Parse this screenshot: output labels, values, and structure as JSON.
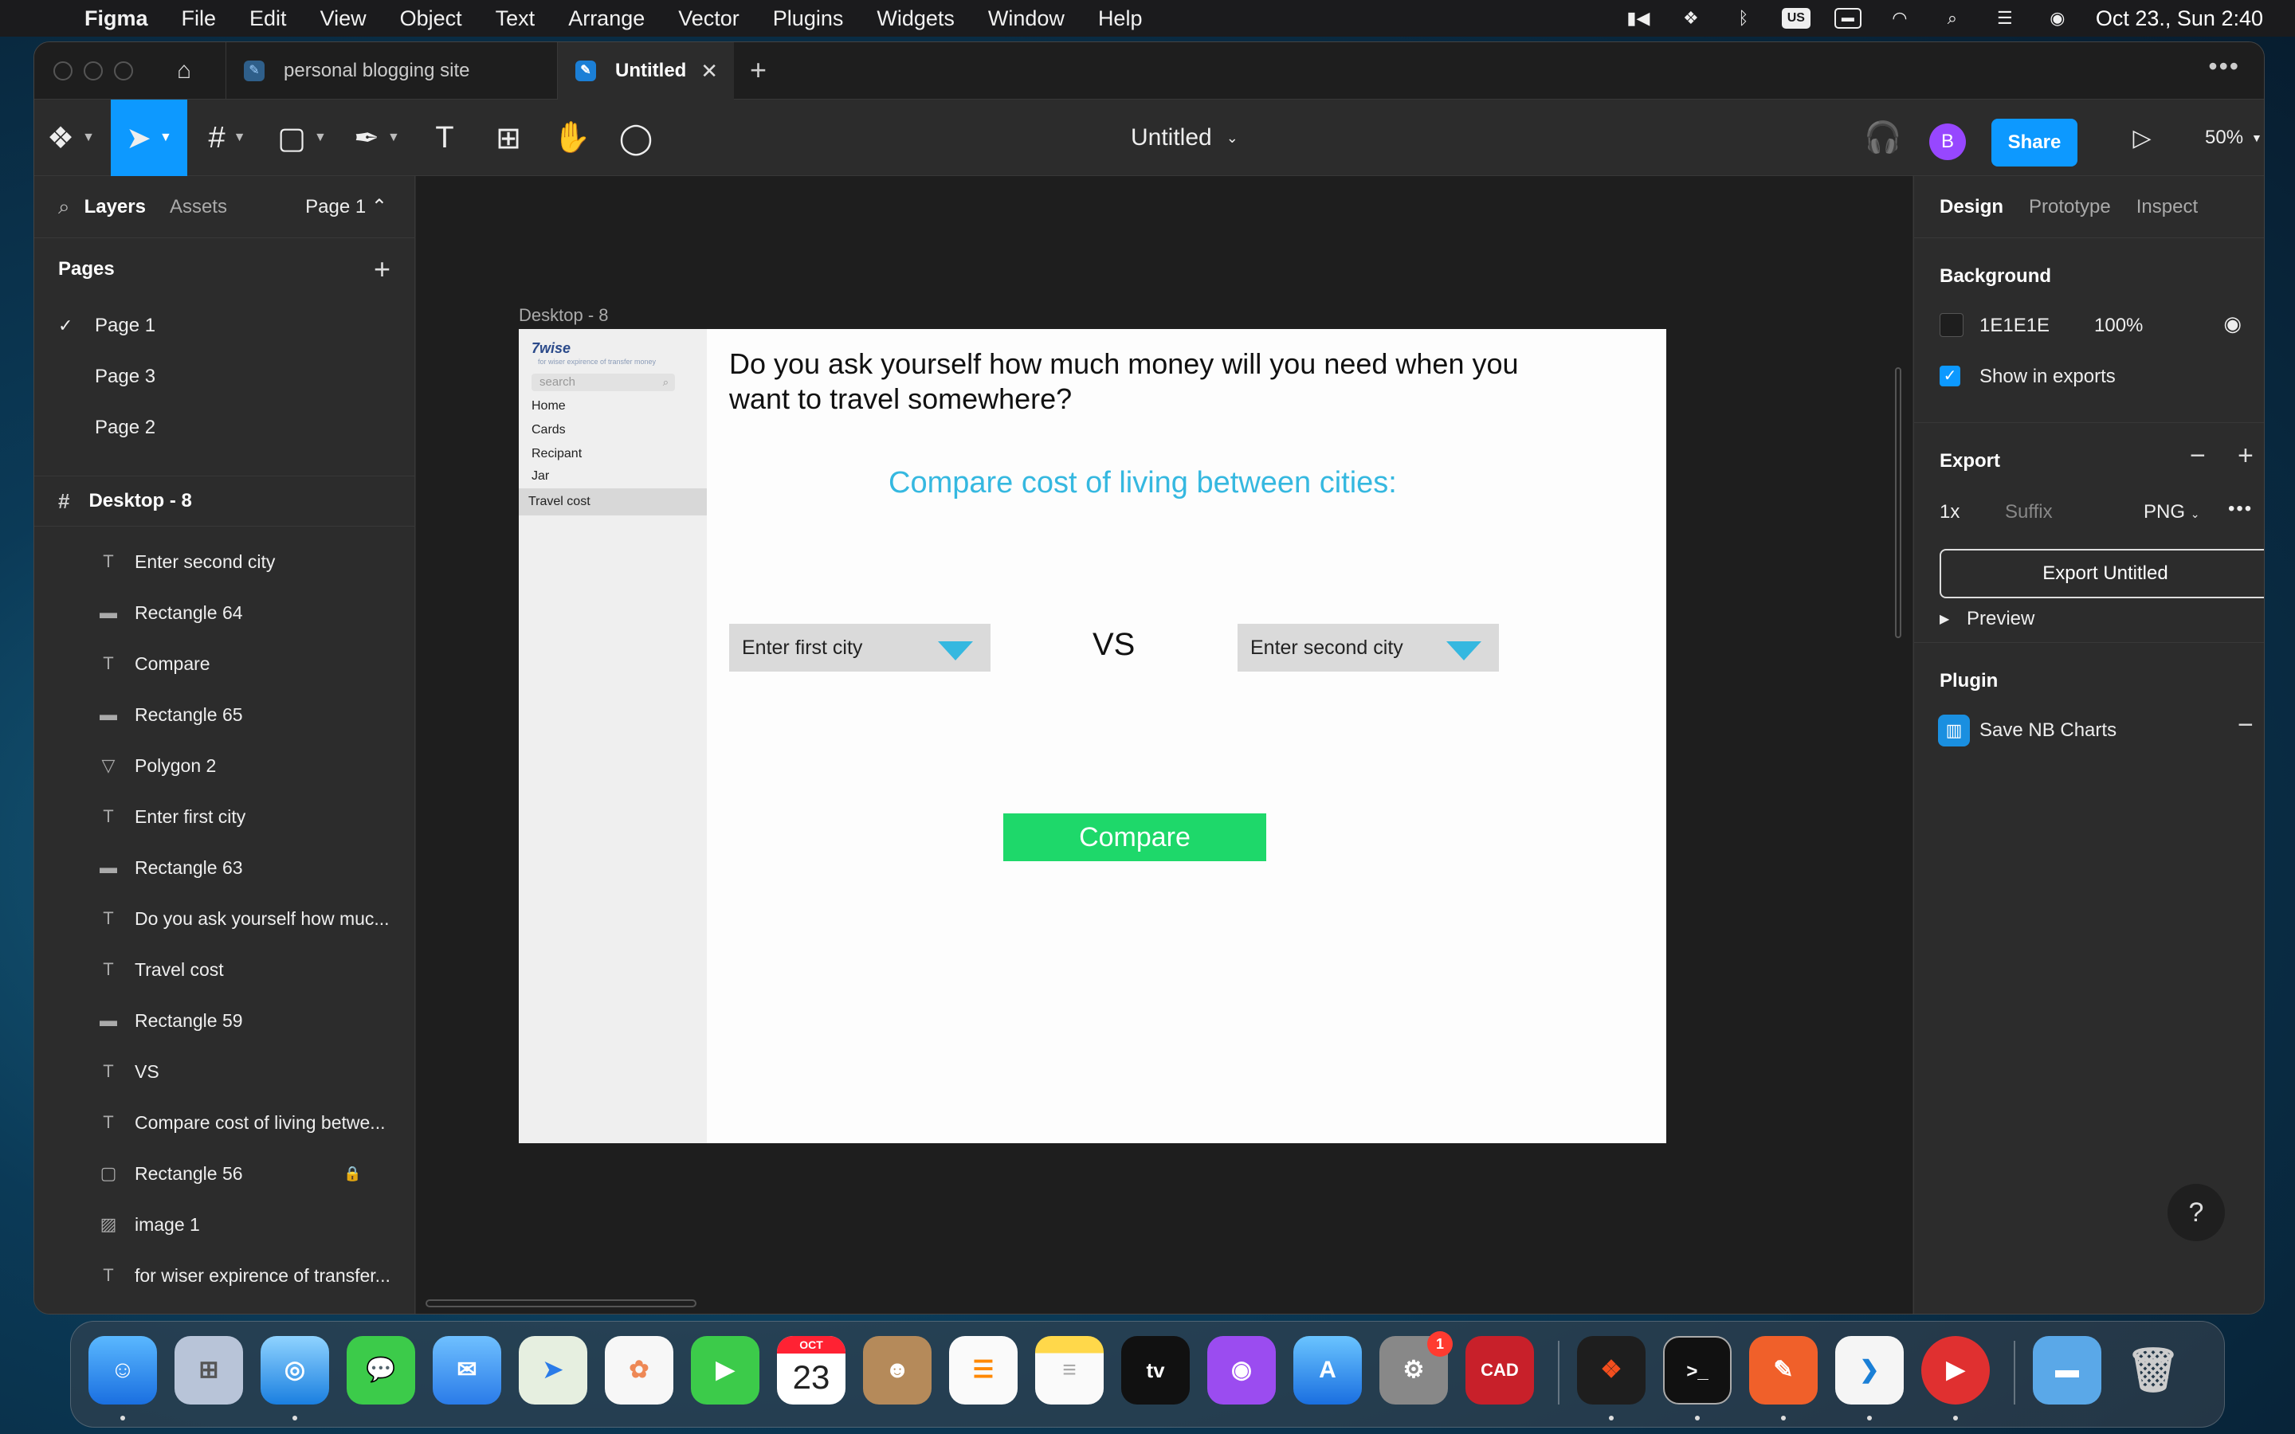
{
  "menubar": {
    "app": "Figma",
    "items": [
      "File",
      "Edit",
      "View",
      "Object",
      "Text",
      "Arrange",
      "Vector",
      "Plugins",
      "Widgets",
      "Window",
      "Help"
    ],
    "keyboard": "US",
    "datetime": "Oct 23., Sun  2:40"
  },
  "tabs": {
    "tab1": "personal blogging site",
    "tab2": "Untitled"
  },
  "toolbar": {
    "file_title": "Untitled",
    "avatar_initial": "B",
    "share_label": "Share",
    "zoom": "50%"
  },
  "left_panel": {
    "layers_tab": "Layers",
    "assets_tab": "Assets",
    "page_selector": "Page 1",
    "pages_heading": "Pages",
    "pages": [
      "Page 1",
      "Page 3",
      "Page 2"
    ],
    "frame_name": "Desktop - 8",
    "layers": [
      {
        "icon": "text",
        "name": "Enter second city"
      },
      {
        "icon": "rect-line",
        "name": "Rectangle 64"
      },
      {
        "icon": "text",
        "name": "Compare"
      },
      {
        "icon": "rect-line",
        "name": "Rectangle 65"
      },
      {
        "icon": "polygon",
        "name": "Polygon 2"
      },
      {
        "icon": "text",
        "name": "Enter first city"
      },
      {
        "icon": "rect-line",
        "name": "Rectangle 63"
      },
      {
        "icon": "text",
        "name": "Do you ask yourself how muc..."
      },
      {
        "icon": "text",
        "name": "Travel cost"
      },
      {
        "icon": "rect-line",
        "name": "Rectangle 59"
      },
      {
        "icon": "text",
        "name": "VS"
      },
      {
        "icon": "text",
        "name": "Compare cost of living betwe..."
      },
      {
        "icon": "rect",
        "name": "Rectangle 56",
        "locked": true
      },
      {
        "icon": "image",
        "name": "image 1"
      },
      {
        "icon": "text",
        "name": "for wiser expirence of transfer..."
      }
    ]
  },
  "canvas": {
    "frame_label": "Desktop - 8",
    "logo": "7wise",
    "tagline": "for wiser expirence of transfer money",
    "search_placeholder": "search",
    "nav": [
      "Home",
      "Cards",
      "Recipant",
      "Jar",
      "Travel cost"
    ],
    "question": "Do you ask yourself how much money will you need when you want to travel somewhere?",
    "subtitle": "Compare cost of living between cities:",
    "first_city": "Enter first city",
    "vs": "VS",
    "second_city": "Enter second city",
    "compare_button": "Compare",
    "accent_color": "#35B8E0",
    "button_color": "#1ED86A"
  },
  "right_panel": {
    "tabs": [
      "Design",
      "Prototype",
      "Inspect"
    ],
    "background_title": "Background",
    "bg_hex": "1E1E1E",
    "bg_opacity": "100%",
    "show_in_exports": "Show in exports",
    "export_title": "Export",
    "export_scale": "1x",
    "suffix_placeholder": "Suffix",
    "format": "PNG",
    "export_button": "Export Untitled",
    "preview": "Preview",
    "plugin_title": "Plugin",
    "plugin_name": "Save NB Charts"
  },
  "help": "?",
  "dock": {
    "calendar_month": "OCT",
    "calendar_day": "23",
    "settings_badge": "1",
    "cad_label": "CAD"
  }
}
